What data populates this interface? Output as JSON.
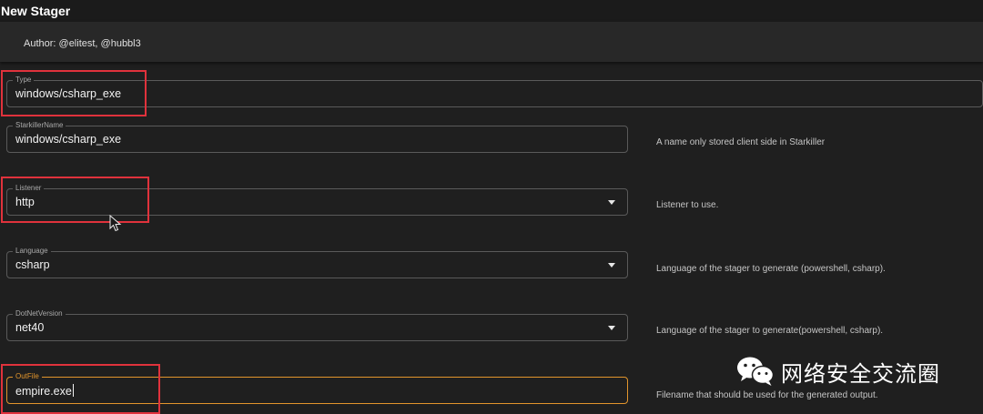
{
  "window": {
    "title": "New Stager"
  },
  "author": {
    "text": "Author: @elitest, @hubbl3"
  },
  "fields": {
    "type": {
      "label": "Type",
      "value": "windows/csharp_exe"
    },
    "starkiller_name": {
      "label": "StarkillerName",
      "value": "windows/csharp_exe",
      "help": "A name only stored client side in Starkiller"
    },
    "listener": {
      "label": "Listener",
      "value": "http",
      "help": "Listener to use."
    },
    "language": {
      "label": "Language",
      "value": "csharp",
      "help": "Language of the stager to generate (powershell, csharp)."
    },
    "dotnet_version": {
      "label": "DotNetVersion",
      "value": "net40",
      "help": "Language of the stager to generate(powershell, csharp)."
    },
    "outfile": {
      "label": "OutFile",
      "value": "empire.exe",
      "help": "Filename that should be used for the generated output."
    }
  },
  "watermark": {
    "text": "网络安全交流圈",
    "icon": "wechat-icon"
  },
  "colors": {
    "highlight": "#e0323c",
    "focus": "#e2952c",
    "background": "#1f1f1f"
  }
}
